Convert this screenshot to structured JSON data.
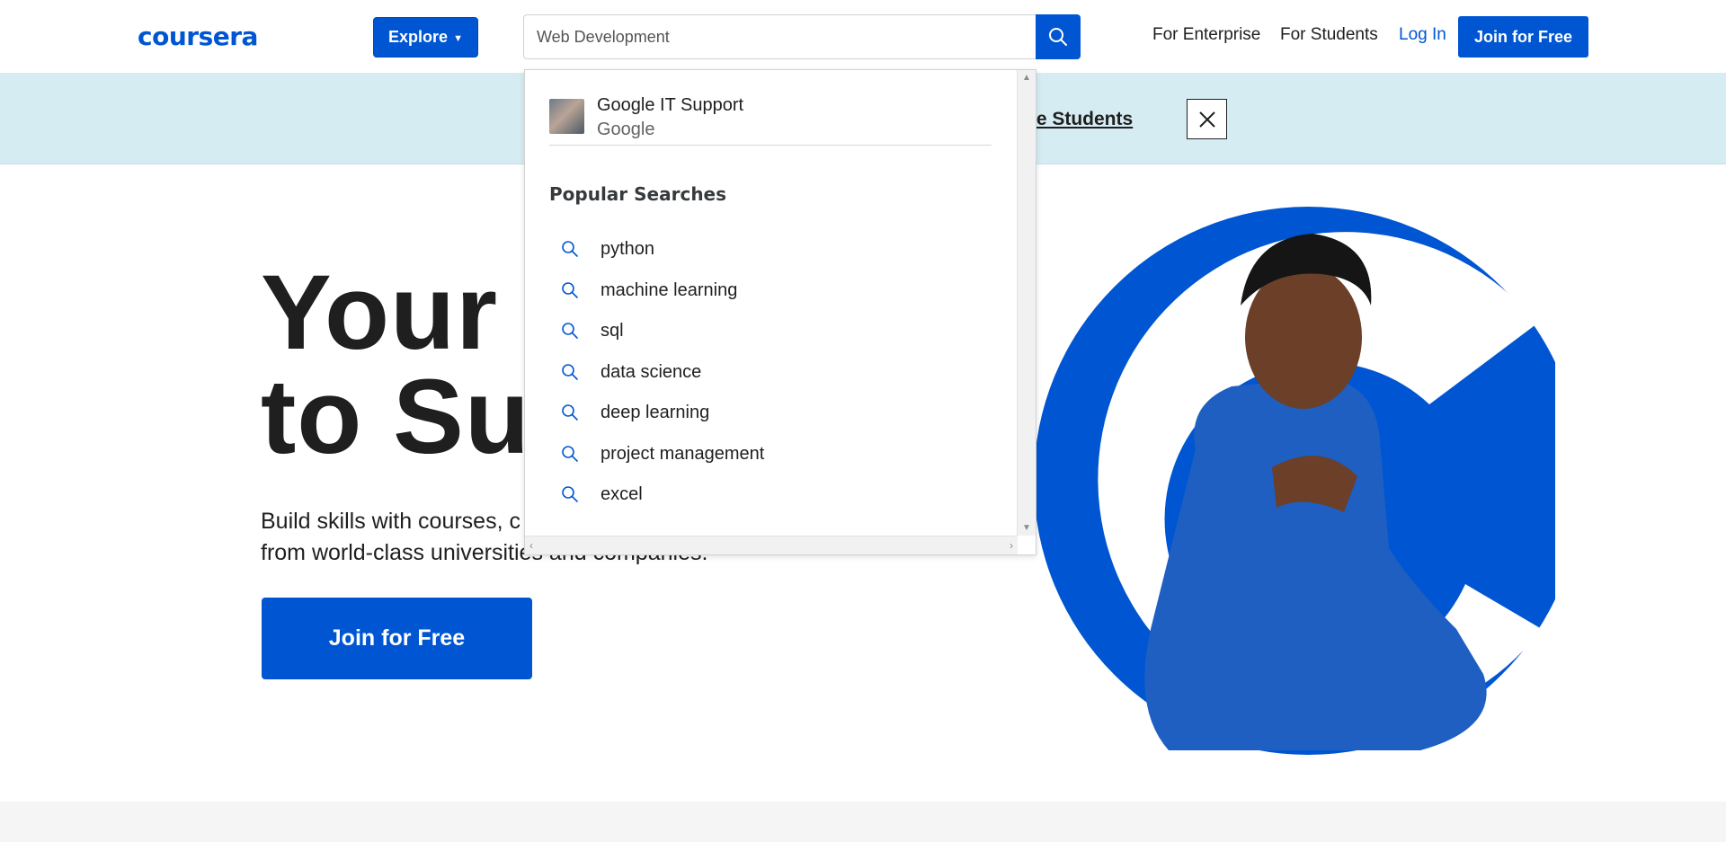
{
  "header": {
    "logo": "coursera",
    "explore_label": "Explore",
    "search": {
      "value": "Web Development"
    },
    "nav": {
      "enterprise": "For Enterprise",
      "students": "For Students",
      "login": "Log In"
    },
    "join_label": "Join for Free"
  },
  "banner": {
    "text": "ge Students"
  },
  "hero": {
    "title_line1": "Your C",
    "title_line2": "to Suc",
    "subtitle_line1": "Build skills with courses, c",
    "subtitle_line2": "from world-class universities and companies.",
    "join_label": "Join for Free"
  },
  "dropdown": {
    "suggestion": {
      "title": "Google IT Support",
      "partner": "Google"
    },
    "popular_heading": "Popular Searches",
    "popular": [
      "python",
      "machine learning",
      "sql",
      "data science",
      "deep learning",
      "project management",
      "excel"
    ]
  },
  "colors": {
    "brand": "#0056d2",
    "banner": "#d6ecf3",
    "text": "#1f1f1f"
  },
  "icons": [
    "search-icon",
    "chevron-down-icon",
    "close-icon"
  ]
}
